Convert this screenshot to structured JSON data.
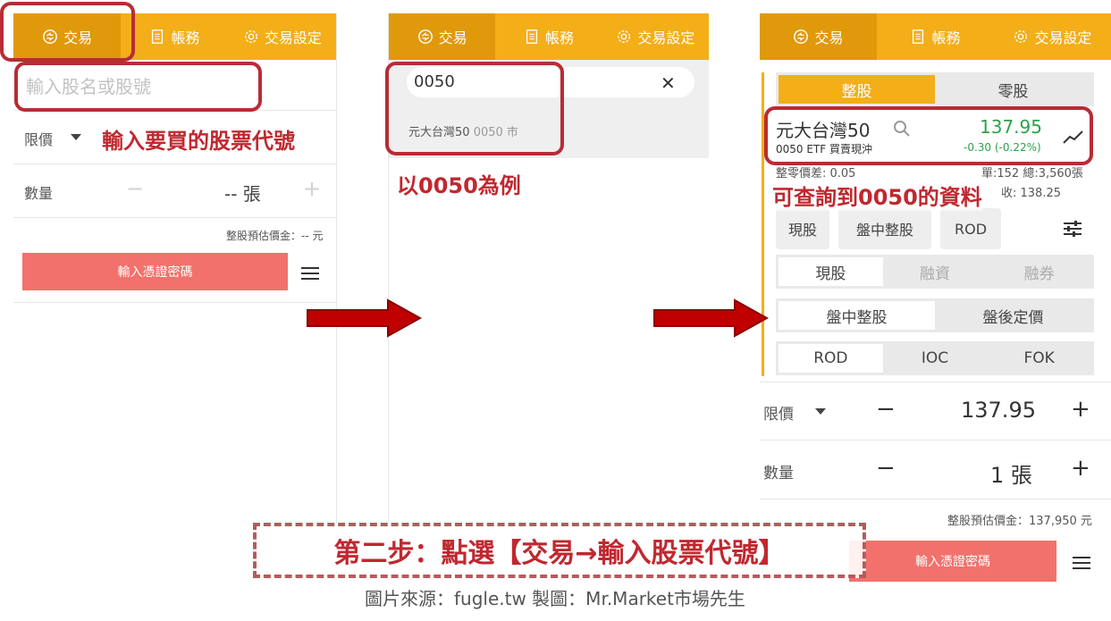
{
  "tabs": {
    "trade": "交易",
    "account": "帳務",
    "settings": "交易設定"
  },
  "panel1": {
    "search_placeholder": "輸入股名或股號",
    "price_type": "限價",
    "quantity_label": "數量",
    "quantity_value": "-- 張",
    "estimate": "整股預估價金：-- 元",
    "password_button": "輸入憑證密碼",
    "minus": "−",
    "plus": "+"
  },
  "panel2": {
    "query": "0050",
    "result_name": "元大台灣50",
    "result_code": "0050 市"
  },
  "panel3": {
    "board_lot": "整股",
    "odd_lot": "零股",
    "stock_name": "元大台灣50",
    "stock_sub": "0050 ETF 買賣現沖",
    "price": "137.95",
    "change": "-0.30 (-0.22%)",
    "info_left": "整零價差: 0.05",
    "info_right": "單:152  總:3,560張",
    "info_right2": "收: 138.25",
    "pills": [
      "現股",
      "盤中整股",
      "ROD"
    ],
    "credit_seg": [
      "現股",
      "融資",
      "融券"
    ],
    "session_seg": [
      "盤中整股",
      "盤後定價"
    ],
    "tif_seg": [
      "ROD",
      "IOC",
      "FOK"
    ],
    "price_type": "限價",
    "price_value": "137.95",
    "quantity_label": "數量",
    "quantity_value": "1 張",
    "estimate": "整股預估價金：137,950 元",
    "password_button": "輸入憑證密碼",
    "minus": "−",
    "plus": "+"
  },
  "annotations": {
    "step1": "輸入要買的股票代號",
    "step2": "以0050為例",
    "step3": "可查詢到0050的資料",
    "step_title": "第二步：點選【交易→輸入股票代號】",
    "credit": "圖片來源：fugle.tw  製圖：Mr.Market市場先生"
  },
  "colors": {
    "brand": "#f3ae18",
    "brand_active": "#e0990a",
    "cta": "#f2716c",
    "highlight": "#b82c36",
    "arrow": "#c00000",
    "price_down": "#2aa34a"
  },
  "icons": [
    "exchange-icon",
    "document-icon",
    "gear-icon",
    "close-icon",
    "search-icon",
    "trend-icon",
    "sliders-icon",
    "menu-icon",
    "info-icon",
    "caret-down-icon"
  ]
}
